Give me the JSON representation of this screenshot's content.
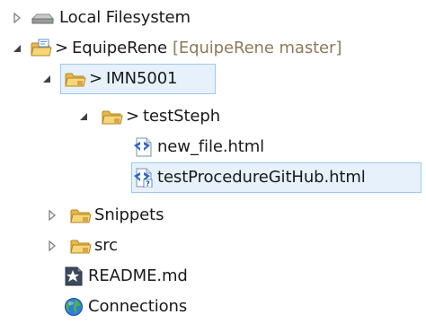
{
  "tree": {
    "local_filesystem": {
      "label": "Local Filesystem"
    },
    "equipe": {
      "prefix": ">",
      "label": "EquipeRene",
      "decoration": "[EquipeRene master]"
    },
    "imn": {
      "prefix": ">",
      "label": "IMN5001"
    },
    "teststeph": {
      "prefix": ">",
      "label": "testSteph"
    },
    "new_file": {
      "label": "new_file.html"
    },
    "test_procedure": {
      "label": "testProcedureGitHub.html"
    },
    "snippets": {
      "label": "Snippets"
    },
    "src": {
      "label": "src"
    },
    "readme": {
      "label": "README.md"
    },
    "connections": {
      "label": "Connections"
    }
  },
  "colors": {
    "selection_bg": "#e6f1fc",
    "selection_border": "#99c9f3",
    "folder": "#e8b84a",
    "decoration_text": "#8c7a5a"
  }
}
